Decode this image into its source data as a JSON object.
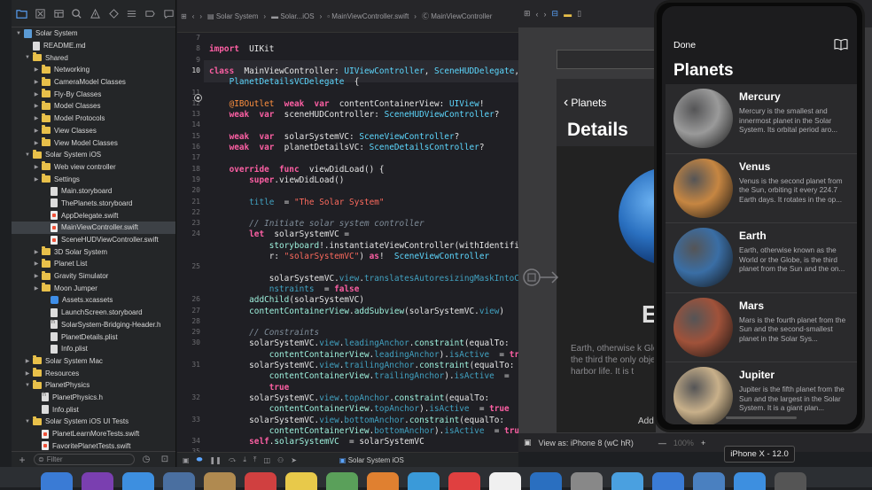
{
  "navigator": {
    "tree": [
      {
        "label": "Solar System",
        "icon": "proj",
        "indent": 0,
        "disclosure": "open"
      },
      {
        "label": "README.md",
        "icon": "file",
        "indent": 1,
        "disclosure": ""
      },
      {
        "label": "Shared",
        "icon": "folder",
        "indent": 1,
        "disclosure": "open"
      },
      {
        "label": "Networking",
        "icon": "folder",
        "indent": 2,
        "disclosure": "closed"
      },
      {
        "label": "CameraModel Classes",
        "icon": "folder",
        "indent": 2,
        "disclosure": "closed"
      },
      {
        "label": "Fly-By Classes",
        "icon": "folder",
        "indent": 2,
        "disclosure": "closed"
      },
      {
        "label": "Model Classes",
        "icon": "folder",
        "indent": 2,
        "disclosure": "closed"
      },
      {
        "label": "Model Protocols",
        "icon": "folder",
        "indent": 2,
        "disclosure": "closed"
      },
      {
        "label": "View Classes",
        "icon": "folder",
        "indent": 2,
        "disclosure": "closed"
      },
      {
        "label": "View Model Classes",
        "icon": "folder",
        "indent": 2,
        "disclosure": "closed"
      },
      {
        "label": "Solar System iOS",
        "icon": "folder",
        "indent": 1,
        "disclosure": "open"
      },
      {
        "label": "Web view controller",
        "icon": "folder",
        "indent": 2,
        "disclosure": "closed"
      },
      {
        "label": "Settings",
        "icon": "folder",
        "indent": 2,
        "disclosure": "closed"
      },
      {
        "label": "Main.storyboard",
        "icon": "file",
        "indent": 3,
        "disclosure": ""
      },
      {
        "label": "ThePlanets.storyboard",
        "icon": "file",
        "indent": 3,
        "disclosure": ""
      },
      {
        "label": "AppDelegate.swift",
        "icon": "swift",
        "indent": 3,
        "disclosure": ""
      },
      {
        "label": "MainViewController.swift",
        "icon": "swift",
        "indent": 3,
        "disclosure": "",
        "selected": true
      },
      {
        "label": "SceneHUDViewController.swift",
        "icon": "swift",
        "indent": 3,
        "disclosure": ""
      },
      {
        "label": "3D Solar System",
        "icon": "folder",
        "indent": 2,
        "disclosure": "closed"
      },
      {
        "label": "Planet List",
        "icon": "folder",
        "indent": 2,
        "disclosure": "closed"
      },
      {
        "label": "Gravity Simulator",
        "icon": "folder",
        "indent": 2,
        "disclosure": "closed"
      },
      {
        "label": "Moon Jumper",
        "icon": "folder",
        "indent": 2,
        "disclosure": "closed"
      },
      {
        "label": "Assets.xcassets",
        "icon": "assets",
        "indent": 3,
        "disclosure": ""
      },
      {
        "label": "LaunchScreen.storyboard",
        "icon": "file",
        "indent": 3,
        "disclosure": ""
      },
      {
        "label": "SolarSystem-Bridging-Header.h",
        "icon": "header",
        "indent": 3,
        "disclosure": ""
      },
      {
        "label": "PlanetDetails.plist",
        "icon": "file",
        "indent": 3,
        "disclosure": ""
      },
      {
        "label": "Info.plist",
        "icon": "file",
        "indent": 3,
        "disclosure": ""
      },
      {
        "label": "Solar System Mac",
        "icon": "folder",
        "indent": 1,
        "disclosure": "closed"
      },
      {
        "label": "Resources",
        "icon": "folder",
        "indent": 1,
        "disclosure": "closed"
      },
      {
        "label": "PlanetPhysics",
        "icon": "folder",
        "indent": 1,
        "disclosure": "open"
      },
      {
        "label": "PlanetPhysics.h",
        "icon": "header",
        "indent": 2,
        "disclosure": ""
      },
      {
        "label": "Info.plist",
        "icon": "file",
        "indent": 2,
        "disclosure": ""
      },
      {
        "label": "Solar System iOS UI Tests",
        "icon": "folder",
        "indent": 1,
        "disclosure": "open"
      },
      {
        "label": "PlanetLearnMoreTests.swift",
        "icon": "swift",
        "indent": 2,
        "disclosure": ""
      },
      {
        "label": "FavoritePlanetTests.swift",
        "icon": "swift",
        "indent": 2,
        "disclosure": ""
      }
    ],
    "filter_placeholder": "Filter"
  },
  "jumpbar": {
    "crumbs": [
      "Solar System",
      "Solar...iOS",
      "MainViewController.swift",
      "MainViewController"
    ]
  },
  "code": {
    "lines": [
      {
        "n": "7",
        "t": []
      },
      {
        "n": "8",
        "t": [
          [
            "kw",
            "import"
          ],
          [
            "",
            "  UIKit"
          ]
        ]
      },
      {
        "n": "9",
        "t": []
      },
      {
        "n": "10",
        "t": [
          [
            "kw",
            "class"
          ],
          [
            "",
            "  MainViewController: "
          ],
          [
            "ty",
            "UIViewController"
          ],
          [
            "",
            ", "
          ],
          [
            "ty",
            "SceneHUDDelegate"
          ],
          [
            "",
            ","
          ]
        ],
        "cur": true
      },
      {
        "n": "",
        "t": [
          [
            "",
            "    "
          ],
          [
            "ty",
            "PlanetDetailsVCDelegate"
          ],
          [
            "",
            "  {"
          ]
        ]
      },
      {
        "n": "11",
        "t": []
      },
      {
        "n": "12",
        "t": [
          [
            "",
            "    "
          ],
          [
            "at",
            "@IBOutlet"
          ],
          [
            "kw",
            "  weak  var"
          ],
          [
            "",
            "  contentContainerView: "
          ],
          [
            "ty",
            "UIView"
          ],
          [
            "",
            "!"
          ]
        ]
      },
      {
        "n": "13",
        "t": [
          [
            "",
            "    "
          ],
          [
            "kw",
            "weak  var"
          ],
          [
            "",
            "  sceneHUDController: "
          ],
          [
            "ty",
            "SceneHUDViewController"
          ],
          [
            "",
            "?"
          ]
        ]
      },
      {
        "n": "14",
        "t": []
      },
      {
        "n": "15",
        "t": [
          [
            "",
            "    "
          ],
          [
            "kw",
            "weak  var"
          ],
          [
            "",
            "  solarSystemVC: "
          ],
          [
            "ty",
            "SceneViewController"
          ],
          [
            "",
            "?"
          ]
        ]
      },
      {
        "n": "16",
        "t": [
          [
            "",
            "    "
          ],
          [
            "kw",
            "weak  var"
          ],
          [
            "",
            "  planetDetailsVC: "
          ],
          [
            "ty",
            "SceneDetailsController"
          ],
          [
            "",
            "?"
          ]
        ]
      },
      {
        "n": "17",
        "t": []
      },
      {
        "n": "18",
        "t": [
          [
            "",
            "    "
          ],
          [
            "kw",
            "override  func"
          ],
          [
            "",
            "  viewDidLoad() {"
          ]
        ]
      },
      {
        "n": "19",
        "t": [
          [
            "",
            "        "
          ],
          [
            "kw",
            "super"
          ],
          [
            "",
            ".viewDidLoad()"
          ]
        ]
      },
      {
        "n": "20",
        "t": []
      },
      {
        "n": "21",
        "t": [
          [
            "",
            "        "
          ],
          [
            "pr",
            "title"
          ],
          [
            "",
            "  = "
          ],
          [
            "st",
            "\"The Solar System\""
          ]
        ]
      },
      {
        "n": "22",
        "t": []
      },
      {
        "n": "23",
        "t": [
          [
            "",
            "        "
          ],
          [
            "cm",
            "// Initiate solar system controller"
          ]
        ]
      },
      {
        "n": "24",
        "t": [
          [
            "",
            "        "
          ],
          [
            "kw",
            "let"
          ],
          [
            "",
            "  solarSystemVC ="
          ]
        ]
      },
      {
        "n": "",
        "t": [
          [
            "",
            "            "
          ],
          [
            "ty2",
            "storyboard"
          ],
          [
            "",
            "!.instantiateViewController(withIdentifie"
          ]
        ]
      },
      {
        "n": "",
        "t": [
          [
            "",
            "            r: "
          ],
          [
            "st",
            "\"solarSystemVC\""
          ],
          [
            "",
            ") "
          ],
          [
            "kw",
            "as"
          ],
          [
            "",
            "!  "
          ],
          [
            "ty",
            "SceneViewController"
          ]
        ]
      },
      {
        "n": "25",
        "t": []
      },
      {
        "n": "",
        "t": [
          [
            "",
            "            solarSystemVC."
          ],
          [
            "pr",
            "view"
          ],
          [
            "",
            "."
          ],
          [
            "pr",
            "translatesAutoresizingMaskIntoCo"
          ]
        ]
      },
      {
        "n": "",
        "t": [
          [
            "",
            "            "
          ],
          [
            "pr",
            "nstraints"
          ],
          [
            "",
            "  = "
          ],
          [
            "kw",
            "false"
          ]
        ]
      },
      {
        "n": "26",
        "t": [
          [
            "",
            "        "
          ],
          [
            "ty2",
            "addChild"
          ],
          [
            "",
            "(solarSystemVC)"
          ]
        ]
      },
      {
        "n": "27",
        "t": [
          [
            "",
            "        "
          ],
          [
            "ty2",
            "contentContainerView"
          ],
          [
            "",
            "."
          ],
          [
            "ty2",
            "addSubview"
          ],
          [
            "",
            "(solarSystemVC."
          ],
          [
            "pr",
            "view"
          ],
          [
            "",
            ")"
          ]
        ]
      },
      {
        "n": "28",
        "t": []
      },
      {
        "n": "29",
        "t": [
          [
            "",
            "        "
          ],
          [
            "cm",
            "// Constraints"
          ]
        ]
      },
      {
        "n": "30",
        "t": [
          [
            "",
            "        solarSystemVC."
          ],
          [
            "pr",
            "view"
          ],
          [
            "",
            "."
          ],
          [
            "pr",
            "leadingAnchor"
          ],
          [
            "",
            "."
          ],
          [
            "ty2",
            "constraint"
          ],
          [
            "",
            "(equalTo:"
          ]
        ]
      },
      {
        "n": "",
        "t": [
          [
            "",
            "            "
          ],
          [
            "ty2",
            "contentContainerView"
          ],
          [
            "",
            "."
          ],
          [
            "pr",
            "leadingAnchor"
          ],
          [
            "",
            ")."
          ],
          [
            "pr",
            "isActive"
          ],
          [
            "",
            "  = "
          ],
          [
            "kw",
            "true"
          ]
        ]
      },
      {
        "n": "31",
        "t": [
          [
            "",
            "        solarSystemVC."
          ],
          [
            "pr",
            "view"
          ],
          [
            "",
            "."
          ],
          [
            "pr",
            "trailingAnchor"
          ],
          [
            "",
            "."
          ],
          [
            "ty2",
            "constraint"
          ],
          [
            "",
            "(equalTo:"
          ]
        ]
      },
      {
        "n": "",
        "t": [
          [
            "",
            "            "
          ],
          [
            "ty2",
            "contentContainerView"
          ],
          [
            "",
            "."
          ],
          [
            "pr",
            "trailingAnchor"
          ],
          [
            "",
            ")."
          ],
          [
            "pr",
            "isActive"
          ],
          [
            "",
            "  ="
          ]
        ]
      },
      {
        "n": "",
        "t": [
          [
            "",
            "            "
          ],
          [
            "kw",
            "true"
          ]
        ]
      },
      {
        "n": "32",
        "t": [
          [
            "",
            "        solarSystemVC."
          ],
          [
            "pr",
            "view"
          ],
          [
            "",
            "."
          ],
          [
            "pr",
            "topAnchor"
          ],
          [
            "",
            "."
          ],
          [
            "ty2",
            "constraint"
          ],
          [
            "",
            "(equalTo:"
          ]
        ]
      },
      {
        "n": "",
        "t": [
          [
            "",
            "            "
          ],
          [
            "ty2",
            "contentContainerView"
          ],
          [
            "",
            "."
          ],
          [
            "pr",
            "topAnchor"
          ],
          [
            "",
            ")."
          ],
          [
            "pr",
            "isActive"
          ],
          [
            "",
            "  = "
          ],
          [
            "kw",
            "true"
          ]
        ]
      },
      {
        "n": "33",
        "t": [
          [
            "",
            "        solarSystemVC."
          ],
          [
            "pr",
            "view"
          ],
          [
            "",
            "."
          ],
          [
            "pr",
            "bottomAnchor"
          ],
          [
            "",
            "."
          ],
          [
            "ty2",
            "constraint"
          ],
          [
            "",
            "(equalTo:"
          ]
        ]
      },
      {
        "n": "",
        "t": [
          [
            "",
            "            "
          ],
          [
            "ty2",
            "contentContainerView"
          ],
          [
            "",
            "."
          ],
          [
            "pr",
            "bottomAnchor"
          ],
          [
            "",
            ")."
          ],
          [
            "pr",
            "isActive"
          ],
          [
            "",
            "  = "
          ],
          [
            "kw",
            "true"
          ]
        ]
      },
      {
        "n": "34",
        "t": [
          [
            "",
            "        "
          ],
          [
            "kw",
            "self"
          ],
          [
            "",
            "."
          ],
          [
            "ty2",
            "solarSystemVC"
          ],
          [
            "",
            "  = solarSystemVC"
          ]
        ]
      },
      {
        "n": "35",
        "t": []
      }
    ]
  },
  "canvas": {
    "details_back": "Planets",
    "details_title": "Details",
    "details_big_letter": "E",
    "details_desc": "Earth, otherwise k Globe, is the third the only object i harbor life. It is t",
    "details_add": "Add",
    "view_as": "View as: iPhone 8 (wC hR)",
    "zoom": "100%"
  },
  "phone": {
    "done": "Done",
    "title": "Planets",
    "planets": [
      {
        "name": "Mercury",
        "desc": "Mercury is the smallest and innermost planet in the Solar System. Its orbital period aro...",
        "color": "#9a9a9a"
      },
      {
        "name": "Venus",
        "desc": "Venus is the second planet from the Sun, orbiting it every 224.7 Earth days. It rotates in the op...",
        "color": "#c68642"
      },
      {
        "name": "Earth",
        "desc": "Earth, otherwise known as the World or the Globe, is the third planet from the Sun and the on...",
        "color": "#3a6ea5"
      },
      {
        "name": "Mars",
        "desc": "Mars is the fourth planet from the Sun and the second-smallest planet in the Solar Sys...",
        "color": "#a0523a"
      },
      {
        "name": "Jupiter",
        "desc": "Jupiter is the fifth planet from the Sun and the largest in the Solar System. It is a giant plan...",
        "color": "#c8b08a"
      }
    ]
  },
  "tooltip": "iPhone X - 12.0",
  "debug": {
    "scheme": "Solar System iOS"
  },
  "dock": {
    "colors": [
      "#3a7bd5",
      "#7a3fb0",
      "#3d8fe0",
      "#4a6fa0",
      "#b08a50",
      "#d04040",
      "#e8c94a",
      "#5aa05a",
      "#e08030",
      "#3a9ad9",
      "#e04040",
      "#f0f0f0",
      "#2a6fc0",
      "#888888",
      "#4aa0e0",
      "#3a7bd5",
      "#4a80c0",
      "#3d8fe0",
      "#555555"
    ]
  }
}
